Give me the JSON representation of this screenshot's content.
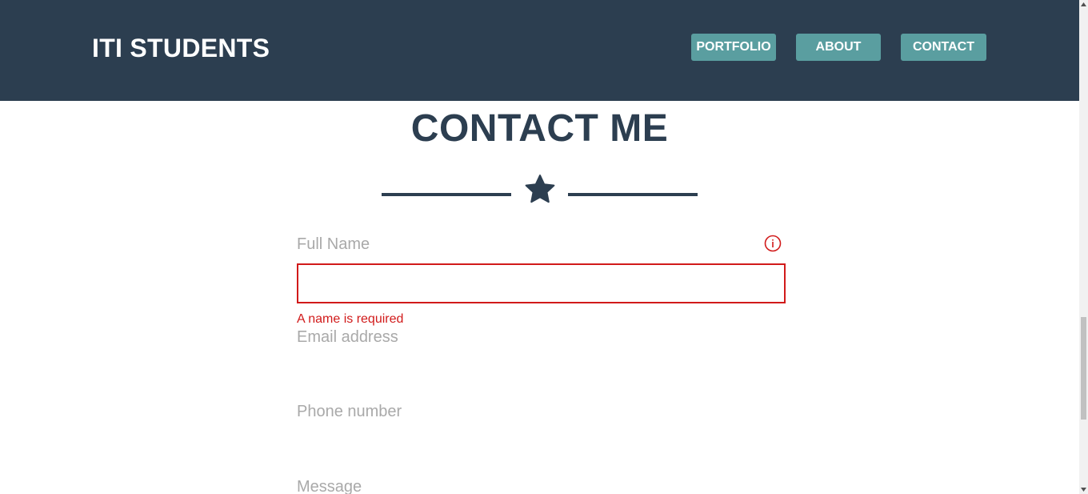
{
  "navbar": {
    "brand": "ITI STUDENTS",
    "links": [
      "PORTFOLIO",
      "ABOUT",
      "CONTACT"
    ],
    "background_color": "#2c3e50",
    "button_color": "#5a9ea0"
  },
  "header": {
    "title": "CONTACT ME",
    "divider_icon": "star-icon"
  },
  "form": {
    "name": {
      "label": "Full Name",
      "value": "",
      "error": "A name is required",
      "error_icon": "info-icon",
      "error_color": "#d11a1a"
    },
    "email": {
      "label": "Email address"
    },
    "phone": {
      "label": "Phone number"
    },
    "message": {
      "label": "Message"
    }
  },
  "scrollbar": {
    "up_icon": "scroll-up-arrow-icon",
    "down_icon": "scroll-down-arrow-icon"
  }
}
